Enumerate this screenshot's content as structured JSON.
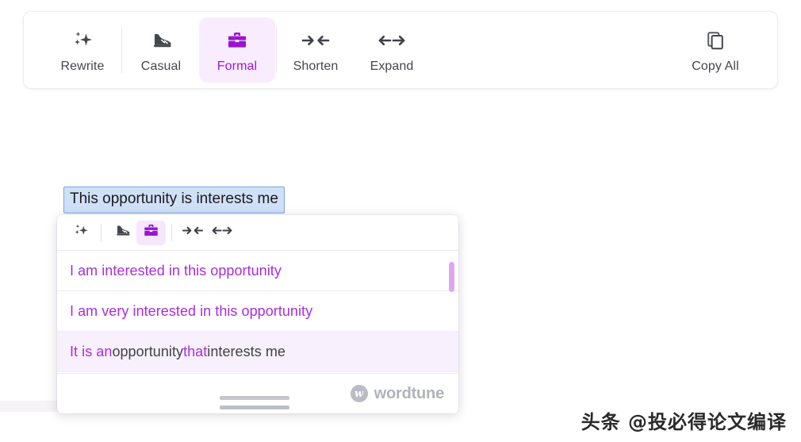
{
  "toolbar": {
    "items": [
      {
        "id": "rewrite",
        "label": "Rewrite",
        "icon": "sparkles-icon",
        "active": false
      },
      {
        "id": "casual",
        "label": "Casual",
        "icon": "sneaker-icon",
        "active": false
      },
      {
        "id": "formal",
        "label": "Formal",
        "icon": "briefcase-icon",
        "active": true
      },
      {
        "id": "shorten",
        "label": "Shorten",
        "icon": "arrows-in-icon",
        "active": false
      },
      {
        "id": "expand",
        "label": "Expand",
        "icon": "arrows-out-icon",
        "active": false
      }
    ],
    "copy_all_label": "Copy All",
    "copy_all_icon": "copy-icon"
  },
  "editor": {
    "selected_text": "This opportunity is interests me"
  },
  "popup": {
    "mini_toolbar": [
      {
        "id": "rewrite",
        "icon": "sparkles-icon",
        "active": false
      },
      {
        "id": "casual",
        "icon": "sneaker-icon",
        "active": false
      },
      {
        "id": "formal",
        "icon": "briefcase-icon",
        "active": true
      },
      {
        "id": "shorten",
        "icon": "arrows-in-icon",
        "active": false
      },
      {
        "id": "expand",
        "icon": "arrows-out-icon",
        "active": false
      }
    ],
    "suggestions": [
      {
        "id": "s1",
        "hovered": false,
        "full_text": "I am interested in this opportunity",
        "parts": [
          {
            "t": "I am interested in this opportunity",
            "c": "purple"
          }
        ]
      },
      {
        "id": "s2",
        "hovered": false,
        "full_text": "I am very interested in this opportunity",
        "parts": [
          {
            "t": "I am very interested in this opportunity",
            "c": "purple"
          }
        ]
      },
      {
        "id": "s3",
        "hovered": true,
        "full_text": "It is an opportunity that interests me",
        "parts": [
          {
            "t": "It is an ",
            "c": "purple"
          },
          {
            "t": "opportunity ",
            "c": "gray"
          },
          {
            "t": "that ",
            "c": "purple"
          },
          {
            "t": "interests me",
            "c": "gray"
          }
        ]
      }
    ],
    "brand_mark": "w",
    "brand_name": "wordtune",
    "resize_handle": "resize-handle"
  },
  "watermark": {
    "text": "头条 @投必得论文编译"
  },
  "colors": {
    "accent_purple": "#a019d9",
    "suggestion_purple": "#a82ee0",
    "active_bg": "#f9ecff",
    "hover_bg": "#f8f0fd",
    "selection_bg": "#cfe0f7",
    "selection_border": "#7ca7df",
    "icon_dark": "#44474c",
    "scrollbar_thumb": "#dfa6f0"
  }
}
